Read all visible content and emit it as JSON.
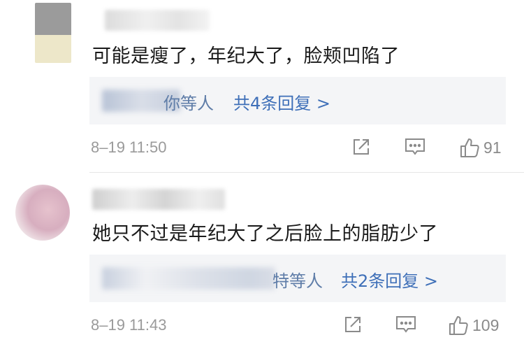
{
  "comments": [
    {
      "text": "可能是瘦了，年纪大了，脸颊凹陷了",
      "reply_names_suffix": "你等人",
      "reply_count": "共4条回复 >",
      "timestamp": "8–19 11:50",
      "likes": "91"
    },
    {
      "text": "她只不过是年纪大了之后脸上的脂肪少了",
      "reply_names_suffix": "特等人",
      "reply_count": "共2条回复 >",
      "timestamp": "8–19 11:43",
      "likes": "109"
    }
  ],
  "icons": {
    "share": "share-icon",
    "comment": "comment-icon",
    "like": "thumbs-up-icon"
  },
  "colors": {
    "link": "#3e6fb8",
    "muted": "#9a9a9a",
    "reply_bg": "#f4f5f7"
  }
}
